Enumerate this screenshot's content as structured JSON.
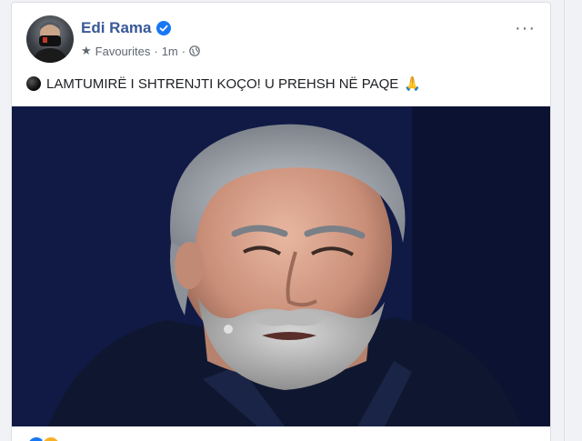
{
  "post": {
    "author": "Edi Rama",
    "audience": "Favourites",
    "separator": "·",
    "time": "1m",
    "more_label": "···",
    "text": "LAMTUMIRË I SHTRENJTI KOÇO! U PREHSH NË PAQE",
    "pray_emoji": "🙏",
    "reaction_count": "",
    "comments_count": ""
  },
  "icons": {
    "verified": "verified-badge-icon",
    "star": "star-icon",
    "globe": "globe-icon",
    "black_circle": "black-circle-emoji-icon"
  },
  "colors": {
    "author_link": "#385898",
    "verified_blue": "#1877f2",
    "meta_grey": "#606770",
    "photo_background": "#121c4a"
  }
}
